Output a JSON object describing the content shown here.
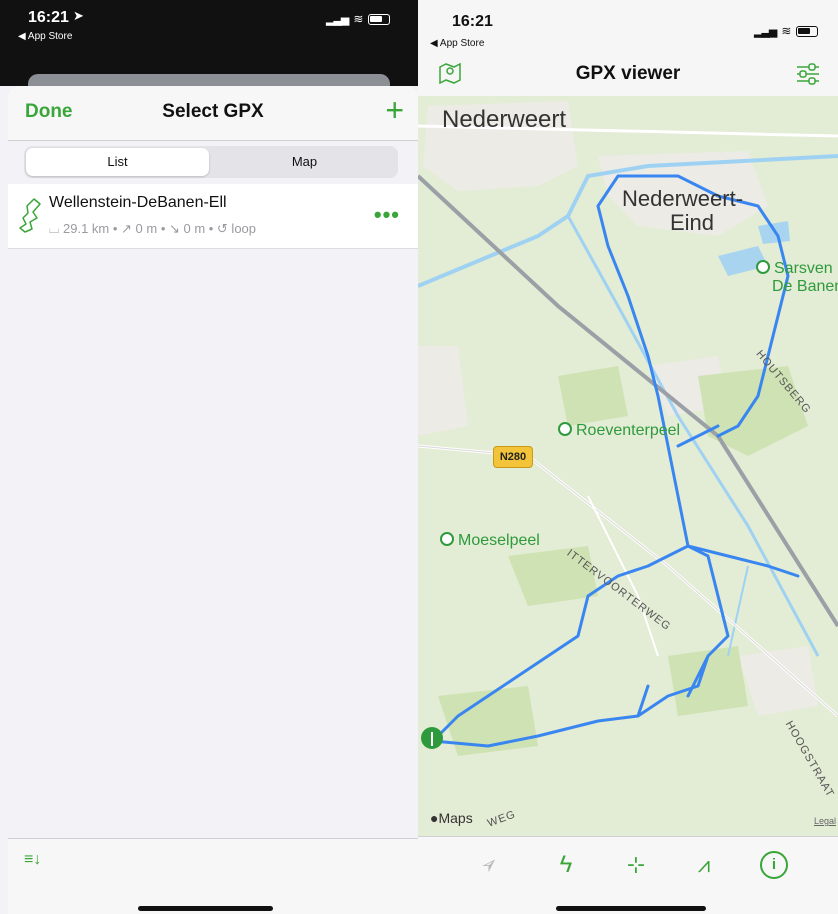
{
  "left": {
    "status": {
      "time": "16:21",
      "back_app": "◀ App Store"
    },
    "nav": {
      "done_label": "Done",
      "title": "Select GPX",
      "add_symbol": "+"
    },
    "segments": [
      {
        "label": "List"
      },
      {
        "label": "Map"
      }
    ],
    "routes": [
      {
        "name": "Wellenstein-DeBanen-Ell",
        "meta": "⌴ 29.1 km • ↗ 0 m • ↘ 0 m • ↺ loop",
        "more_symbol": "•••"
      }
    ],
    "bottom": {
      "sort_symbol": "≡↓"
    }
  },
  "right": {
    "status": {
      "time": "16:21",
      "back_app": "◀ App Store"
    },
    "nav": {
      "title": "GPX viewer"
    },
    "map": {
      "places": [
        "Nederweert",
        "Nederweert-",
        "Eind"
      ],
      "pois": [
        "Roeventerpeel",
        "Moeselpeel",
        "Sarsven",
        "De Banen"
      ],
      "road_sign": "N280",
      "streets": [
        "ITTERVOORTERWEG",
        "HOUTSBERG",
        "HOOGSTRAAT",
        "WEG"
      ],
      "attribution": "Maps",
      "legal": "Legal",
      "route_color": "#3a86f0"
    },
    "toolbar": [
      {
        "icon": "location-arrow-icon",
        "symbol": "➢"
      },
      {
        "icon": "lightning-icon",
        "symbol": "ϟ"
      },
      {
        "icon": "crosshair-icon",
        "symbol": "⊹"
      },
      {
        "icon": "elevation-chart-icon",
        "symbol": "⩘"
      },
      {
        "icon": "info-icon",
        "symbol": "i"
      }
    ]
  }
}
